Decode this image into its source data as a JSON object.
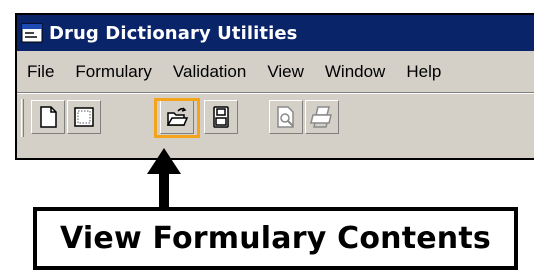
{
  "window": {
    "title": "Drug Dictionary Utilities",
    "icon": "app-icon"
  },
  "menu": {
    "items": [
      "File",
      "Formulary",
      "Validation",
      "View",
      "Window",
      "Help"
    ]
  },
  "toolbar": {
    "buttons": [
      {
        "icon": "new-document-icon",
        "enabled": true
      },
      {
        "icon": "grid-document-icon",
        "enabled": true
      },
      {
        "icon": "open-folder-icon",
        "enabled": true,
        "highlighted": true
      },
      {
        "icon": "save-icon",
        "enabled": true
      },
      {
        "icon": "print-preview-icon",
        "enabled": false
      },
      {
        "icon": "print-icon",
        "enabled": false
      }
    ]
  },
  "annotation": {
    "label": "View Formulary Contents",
    "highlight_color": "#f5a31a"
  }
}
